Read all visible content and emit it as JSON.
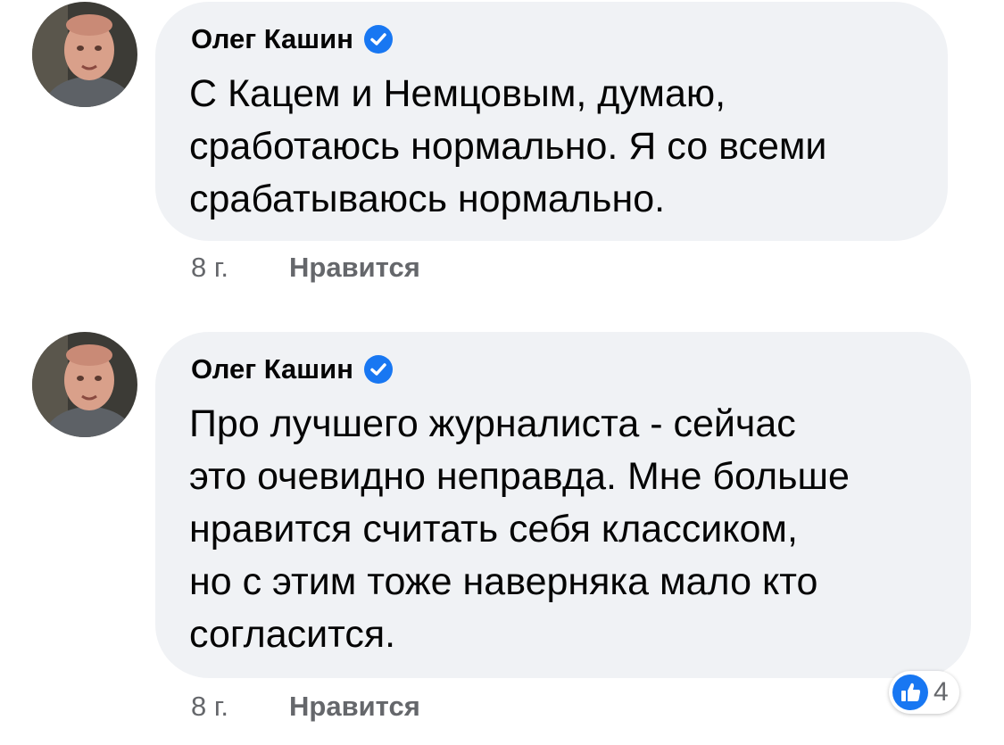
{
  "comments": [
    {
      "author": "Олег Кашин",
      "text": "С Кацем и Немцовым, думаю,\nсработаюсь нормально. Я со всеми\nсрабатываюсь нормально.",
      "time": "8 г.",
      "like_label": "Нравится"
    },
    {
      "author": "Олег Кашин",
      "text": "Про лучшего журналиста - сейчас\nэто очевидно неправда. Мне больше\nнравится считать себя классиком,\nно с этим тоже наверняка мало кто\nсогласится.",
      "time": "8 г.",
      "like_label": "Нравится",
      "reaction_count": "4"
    }
  ],
  "colors": {
    "bubble": "#f0f2f5",
    "verified": "#1877f2",
    "meta": "#65676b"
  }
}
